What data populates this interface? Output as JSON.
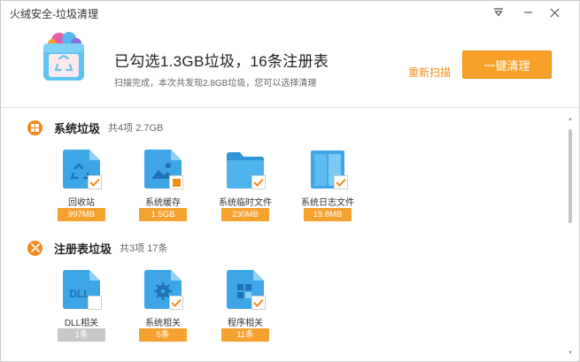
{
  "window": {
    "title": "火绒安全-垃圾清理"
  },
  "header": {
    "summary": "已勾选1.3GB垃圾，16条注册表",
    "subsummary": "扫描完成，本次共发现2.8GB垃圾，您可以选择清理",
    "rescan_label": "重新扫描",
    "clean_label": "一键清理"
  },
  "colors": {
    "accent": "#f7a12a",
    "icon_blue": "#3ea6e6",
    "disabled": "#c8c8c8"
  },
  "sections": [
    {
      "title": "系统垃圾",
      "count": "共4项 2.7GB",
      "icon": "windows-icon",
      "items": [
        {
          "label": "回收站",
          "size": "997MB",
          "checked": true,
          "icon": "recycle-bin-icon"
        },
        {
          "label": "系统缓存",
          "size": "1.5GB",
          "checked": "partial",
          "icon": "image-cache-icon"
        },
        {
          "label": "系统临时文件",
          "size": "230MB",
          "checked": true,
          "icon": "folder-icon"
        },
        {
          "label": "系统日志文件",
          "size": "19.8MB",
          "checked": true,
          "icon": "log-file-icon"
        }
      ]
    },
    {
      "title": "注册表垃圾",
      "count": "共3项 17条",
      "icon": "registry-icon",
      "items": [
        {
          "label": "DLL相关",
          "size": "1条",
          "checked": false,
          "icon": "dll-icon",
          "icon_text": "DLL"
        },
        {
          "label": "系统相关",
          "size": "5条",
          "checked": true,
          "icon": "gear-file-icon"
        },
        {
          "label": "程序相关",
          "size": "11条",
          "checked": true,
          "icon": "program-file-icon"
        }
      ]
    }
  ]
}
